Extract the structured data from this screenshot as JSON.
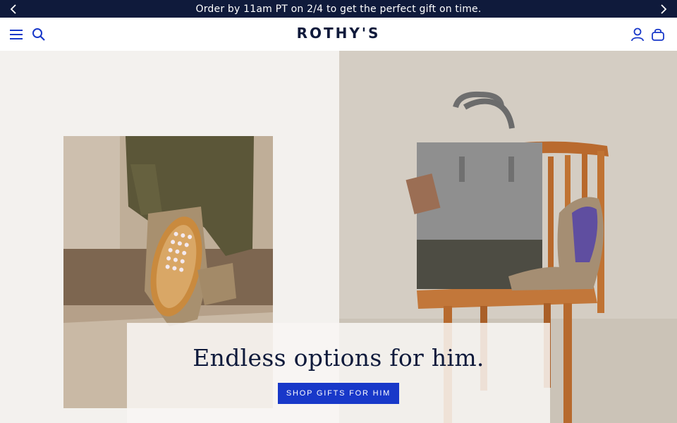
{
  "announcement": {
    "message": "Order by 11am PT on 2/4 to get the perfect gift on time.",
    "prev_icon": "chevron-left-icon",
    "next_icon": "chevron-right-icon"
  },
  "header": {
    "logo": "ROTHY'S",
    "menu_icon": "hamburger-menu-icon",
    "search_icon": "search-icon",
    "account_icon": "account-icon",
    "cart_icon": "shopping-bag-icon"
  },
  "hero": {
    "headline": "Endless options for him.",
    "cta_label": "SHOP GIFTS FOR HIM"
  },
  "colors": {
    "navy": "#0f1a3b",
    "accent_blue": "#1838c9",
    "background": "#f3f1ee"
  }
}
